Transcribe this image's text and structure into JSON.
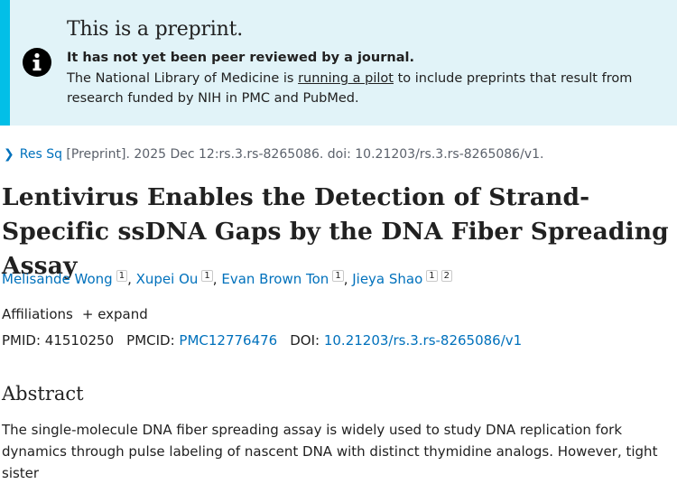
{
  "banner": {
    "title": "This is a preprint.",
    "strong": "It has not yet been peer reviewed by a journal.",
    "text_before": "The National Library of Medicine is ",
    "link": "running a pilot",
    "text_after": " to include preprints that result from research funded by NIH in PMC and PubMed."
  },
  "citation": {
    "journal": "Res Sq",
    "details": " [Preprint]. 2025 Dec 12:rs.3.rs-8265086. doi: 10.21203/rs.3.rs-8265086/v1."
  },
  "article": {
    "title": "Lentivirus Enables the Detection of Strand-Specific ssDNA Gaps by the DNA Fiber Spreading Assay"
  },
  "authors": [
    {
      "name": "Melisande Wong",
      "sups": [
        "1"
      ]
    },
    {
      "name": "Xupei Ou",
      "sups": [
        "1"
      ]
    },
    {
      "name": "Evan Brown Ton",
      "sups": [
        "1"
      ]
    },
    {
      "name": "Jieya Shao",
      "sups": [
        "1",
        "2"
      ]
    }
  ],
  "affiliations": {
    "label": "Affiliations",
    "expand": "expand"
  },
  "ids": {
    "pmid_label": "PMID: ",
    "pmid": "41510250",
    "pmcid_label": "PMCID: ",
    "pmcid": "PMC12776476",
    "doi_label": "DOI: ",
    "doi": "10.21203/rs.3.rs-8265086/v1"
  },
  "abstract": {
    "heading": "Abstract",
    "text": "The single-molecule DNA fiber spreading assay is widely used to study DNA replication fork dynamics through pulse labeling of nascent DNA with distinct thymidine analogs. However, tight sister"
  },
  "icons": {
    "info": "info-circle-icon",
    "chevron": "chevron-right-icon",
    "plus": "plus-icon"
  },
  "colors": {
    "banner_bg": "#e1f3f8",
    "banner_bar": "#02bfe7",
    "link": "#0071bc",
    "text": "#212121"
  }
}
